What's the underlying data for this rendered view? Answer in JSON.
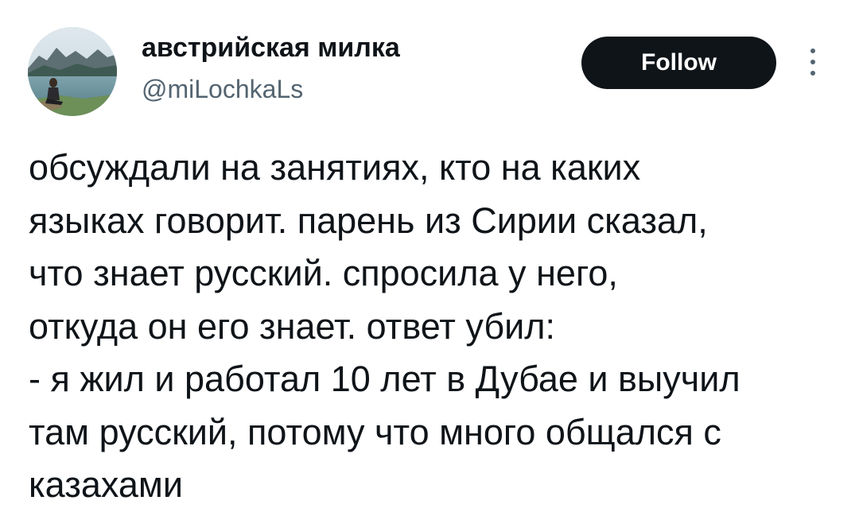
{
  "author": {
    "display_name": "австрийская милка",
    "handle": "@miLochkaLs",
    "avatar_icon": "profile-photo-lake-mountains"
  },
  "actions": {
    "follow_label": "Follow",
    "more_icon": "more-vertical-icon"
  },
  "tweet": {
    "text": "обсуждали на занятиях, кто на каких\nязыках говорит. парень из Сирии сказал,\nчто знает русский. спросила у него,\nоткуда он его знает. ответ убил:\n- я жил и работал 10 лет в Дубае и выучил\nтам русский, потому что много общался с\nказахами"
  },
  "colors": {
    "text": "#0f1419",
    "secondary": "#536471",
    "button_bg": "#0f1419",
    "button_text": "#ffffff"
  }
}
